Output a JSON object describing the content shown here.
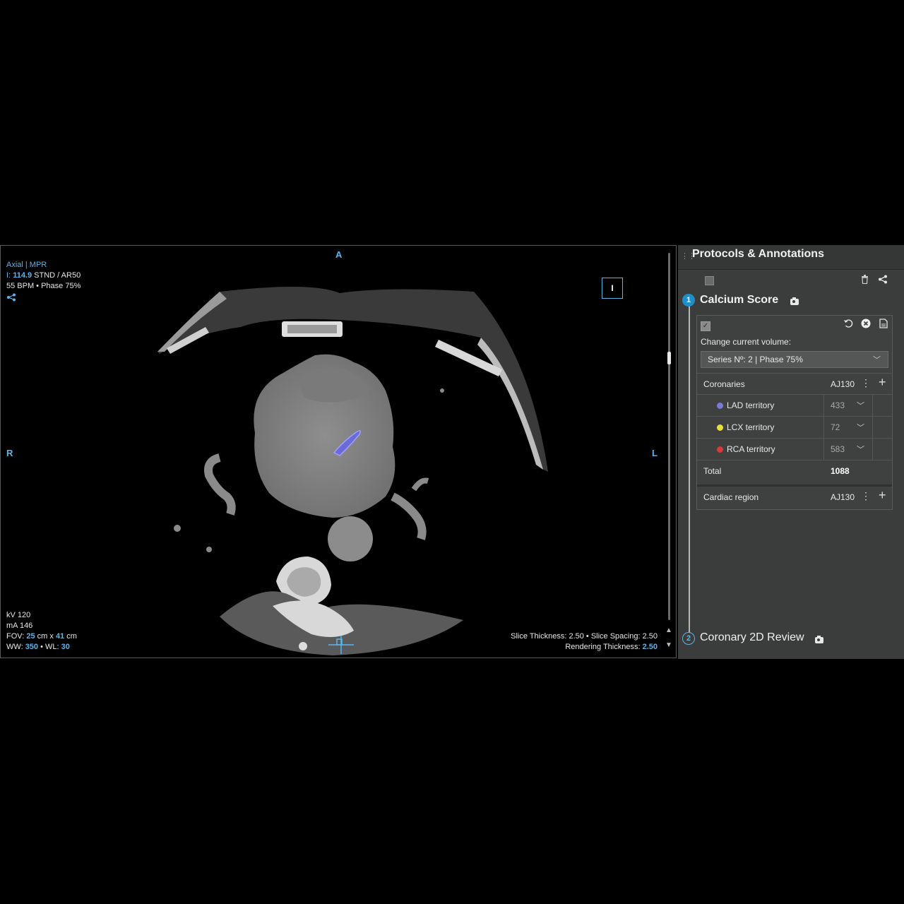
{
  "viewer": {
    "top_left": {
      "view": "Axial | MPR",
      "i_prefix": "I:",
      "i_value": "114.9",
      "kernel": "STND / AR50",
      "cardiac": "55 BPM • Phase 75%",
      "share_icon": "share-icon"
    },
    "orientation": {
      "top": "A",
      "left": "R",
      "right": "L"
    },
    "i_box": "I",
    "bottom_left": {
      "kv": "kV 120",
      "ma": "mA 146",
      "fov_label": "FOV:",
      "fov_w": "25",
      "fov_mid": "cm x",
      "fov_h": "41",
      "fov_unit": "cm",
      "ww_label": "WW:",
      "ww_value": "350",
      "wl_label": "• WL:",
      "wl_value": "30"
    },
    "bottom_right": {
      "slice": "Slice Thickness: 2.50 • Slice Spacing: 2.50",
      "render_label": "Rendering Thickness:",
      "render_value": "2.50"
    }
  },
  "panel": {
    "title": "Protocols & Annotations",
    "steps": [
      {
        "num": "1",
        "title": "Calcium Score"
      },
      {
        "num": "2",
        "title": "Coronary 2D Review"
      }
    ],
    "card": {
      "change_volume_label": "Change current volume:",
      "selected_volume": "Series Nº: 2 | Phase 75%",
      "coronaries": {
        "name": "Coronaries",
        "code": "AJ130"
      },
      "territories": [
        {
          "name": "LAD territory",
          "value": "433",
          "color": "#7b7bd6"
        },
        {
          "name": "LCX territory",
          "value": "72",
          "color": "#e8e03a"
        },
        {
          "name": "RCA territory",
          "value": "583",
          "color": "#d63a3a"
        }
      ],
      "total": {
        "name": "Total",
        "value": "1088"
      },
      "cardiac_region": {
        "name": "Cardiac region",
        "code": "AJ130"
      }
    }
  }
}
